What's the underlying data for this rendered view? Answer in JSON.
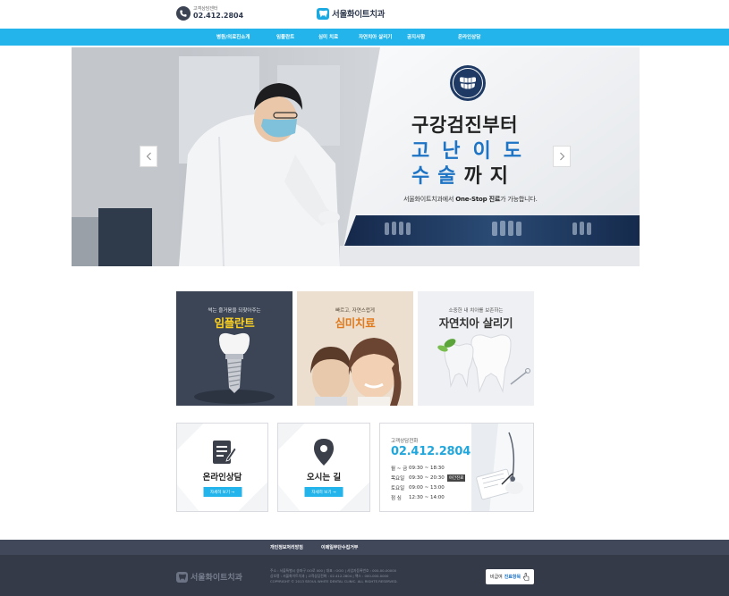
{
  "header": {
    "phone_label": "고객상담센터",
    "phone_number": "02.412.2804",
    "logo_text": "서울화이트치과"
  },
  "nav": {
    "items": [
      {
        "label": "병원/의료진소개"
      },
      {
        "label": "임플란트"
      },
      {
        "label": "심미 치료"
      },
      {
        "label": "자연치아 살리기"
      },
      {
        "label": "공지사항"
      },
      {
        "label": "온라인상담"
      }
    ]
  },
  "hero": {
    "line1": "구강검진부터",
    "line2": "고난이도",
    "line3_part1": "수술",
    "line3_part2": "까지",
    "sub_prefix": "서울화이트치과에서 ",
    "sub_bold": "One-Stop 진료",
    "sub_suffix": "가 가능합니다."
  },
  "cards": [
    {
      "subtitle": "썩는 즐거움을 되찾아주는",
      "title": "임플란트"
    },
    {
      "subtitle": "빠르고, 자연스럽게",
      "title": "심미치료"
    },
    {
      "subtitle": "소중한 내 치아를 보존하는",
      "title": "자연치아 살리기"
    }
  ],
  "boxes": [
    {
      "title": "온라인상담",
      "button": "자세히 보기 →"
    },
    {
      "title": "오시는 길",
      "button": "자세히 보기 →"
    }
  ],
  "contact": {
    "label": "고객상담전화",
    "number": "02.412.2804",
    "hours": [
      {
        "day": "월 ~ 금",
        "time": "09:30 ~ 18:30",
        "tag": ""
      },
      {
        "day": "목요일",
        "time": "09:30 ~ 20:30",
        "tag": "야간진료"
      },
      {
        "day": "토요일",
        "time": "09:00 ~ 13:00",
        "tag": ""
      },
      {
        "day": "점 심",
        "time": "12:30 ~ 14:00",
        "tag": ""
      }
    ]
  },
  "footer": {
    "links": [
      "개인정보처리방침",
      "이메일무단수집거부"
    ],
    "logo_text": "서울화이트치과",
    "info_line1": "주소 : 서울특별시 송파구 OO로 000 | 대표 : OOO | 사업자등록번호 : 000-00-00000",
    "info_line2": "상호명 : 서울화이트치과 | 고객상담전화 : 02.412.2804 | 팩스 : 000-000-0000",
    "info_line3": "COPYRIGHT © 2013 SEOUL WHITE DENTAL CLINIC. ALL RIGHTS RESERVED.",
    "btn_prefix": "비급여",
    "btn_bold": "진료항목"
  }
}
